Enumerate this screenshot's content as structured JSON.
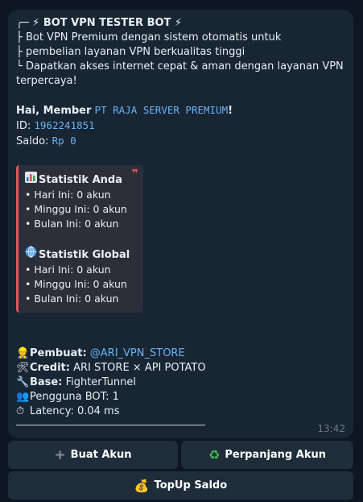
{
  "message": {
    "header": "╭─ ⚡ BOT VPN TESTER BOT ⚡",
    "desc": [
      "├ Bot VPN Premium dengan sistem otomatis untuk",
      "├ pembelian layanan VPN berkualitas tinggi",
      "└ Dapatkan akses internet cepat & aman dengan layanan VPN",
      "terpercaya!"
    ],
    "greeting_prefix": "Hai, Member",
    "member_name": "PT RAJA SERVER PREMIUM",
    "greeting_suffix": "!",
    "id_label": "ID:",
    "id_value": "1962241851",
    "saldo_label": "Saldo:",
    "saldo_value": "Rp 0"
  },
  "stats": {
    "quote_mark": "❞",
    "personal": {
      "icon": "bar-chart-icon",
      "title": "Statistik Anda",
      "items": [
        "• Hari Ini: 0 akun",
        "• Minggu Ini: 0 akun",
        "• Bulan Ini: 0 akun"
      ]
    },
    "global": {
      "icon": "globe-icon",
      "title": "Statistik Global",
      "items": [
        "• Hari Ini: 0 akun",
        "• Minggu Ini: 0 akun",
        "• Bulan Ini: 0 akun"
      ]
    }
  },
  "footer": {
    "pembuat_label": "Pembuat:",
    "pembuat_value": "@ARI_VPN_STORE",
    "credit_label": "Credit:",
    "credit_value": "ARI STORE × API POTATO",
    "base_label": "Base:",
    "base_value": "FighterTunnel",
    "pengguna": "Pengguna BOT: 1",
    "latency": "Latency: 0.04 ms"
  },
  "time": "13:42",
  "buttons": {
    "buat_akun": "Buat Akun",
    "perpanjang": "Perpanjang Akun",
    "topup": "TopUp Saldo"
  },
  "colors": {
    "background": "#0e1621",
    "bubble": "#182533",
    "link": "#6ab3f3",
    "quote_border": "#e5535b",
    "button": "#1f2d3b"
  }
}
